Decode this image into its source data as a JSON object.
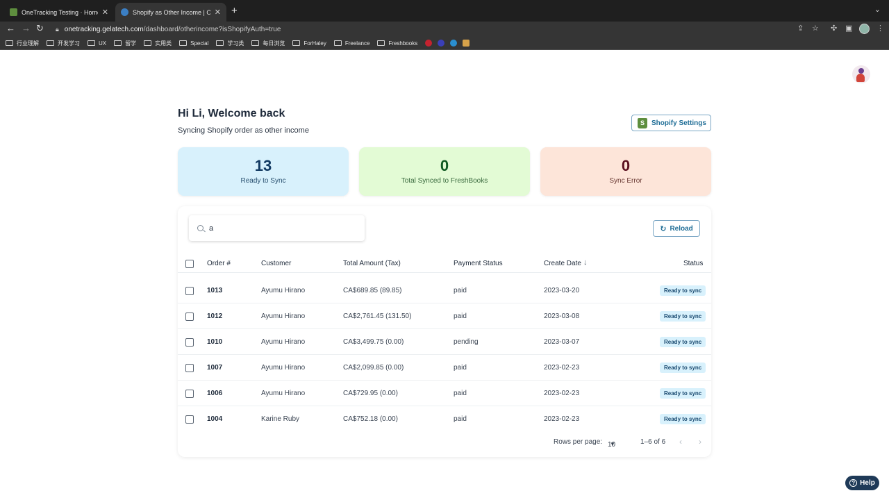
{
  "browser": {
    "tabs": [
      {
        "title": "OneTracking Testing · Home · Sh",
        "active": false
      },
      {
        "title": "Shopify as Other Income | OneTr",
        "active": true
      }
    ],
    "new_tab": "+",
    "url_host": "onetracking.gelatech.com",
    "url_path": "/dashboard/otherincome?isShopifyAuth=true",
    "bookmarks": [
      "行业理解",
      "开发学习",
      "UX",
      "留学",
      "实用类",
      "Special",
      "学习类",
      "每日浏览",
      "ForHaley",
      "Freelance",
      "Freshbooks"
    ]
  },
  "header": {
    "greeting": "Hi Li, Welcome back",
    "subtitle": "Syncing Shopify order as other income",
    "shopify_settings_label": "Shopify Settings"
  },
  "stats": {
    "ready": {
      "value": "13",
      "label": "Ready to Sync"
    },
    "synced": {
      "value": "0",
      "label": "Total Synced to FreshBooks"
    },
    "error": {
      "value": "0",
      "label": "Sync Error"
    }
  },
  "search": {
    "value": "a"
  },
  "reload_label": "Reload",
  "table": {
    "columns": {
      "order": "Order #",
      "customer": "Customer",
      "total": "Total Amount (Tax)",
      "payment": "Payment Status",
      "date": "Create Date",
      "status": "Status"
    },
    "rows": [
      {
        "order": "1013",
        "customer": "Ayumu Hirano",
        "total": "CA$689.85 (89.85)",
        "payment": "paid",
        "date": "2023-03-20",
        "status": "Ready to sync"
      },
      {
        "order": "1012",
        "customer": "Ayumu Hirano",
        "total": "CA$2,761.45 (131.50)",
        "payment": "paid",
        "date": "2023-03-08",
        "status": "Ready to sync"
      },
      {
        "order": "1010",
        "customer": "Ayumu Hirano",
        "total": "CA$3,499.75 (0.00)",
        "payment": "pending",
        "date": "2023-03-07",
        "status": "Ready to sync"
      },
      {
        "order": "1007",
        "customer": "Ayumu Hirano",
        "total": "CA$2,099.85 (0.00)",
        "payment": "paid",
        "date": "2023-02-23",
        "status": "Ready to sync"
      },
      {
        "order": "1006",
        "customer": "Ayumu Hirano",
        "total": "CA$729.95 (0.00)",
        "payment": "paid",
        "date": "2023-02-23",
        "status": "Ready to sync"
      },
      {
        "order": "1004",
        "customer": "Karine Ruby",
        "total": "CA$752.18 (0.00)",
        "payment": "paid",
        "date": "2023-02-23",
        "status": "Ready to sync"
      }
    ]
  },
  "pagination": {
    "rows_per_page_label": "Rows per page:",
    "rows_per_page": "10",
    "range": "1–6 of 6"
  },
  "help_label": "Help",
  "colors": {
    "accent": "#1f6d96",
    "ready_bg": "#d8f1fc",
    "synced_bg": "#e3fbd5",
    "error_bg": "#fde5d9",
    "help_bg": "#1f3a58"
  }
}
